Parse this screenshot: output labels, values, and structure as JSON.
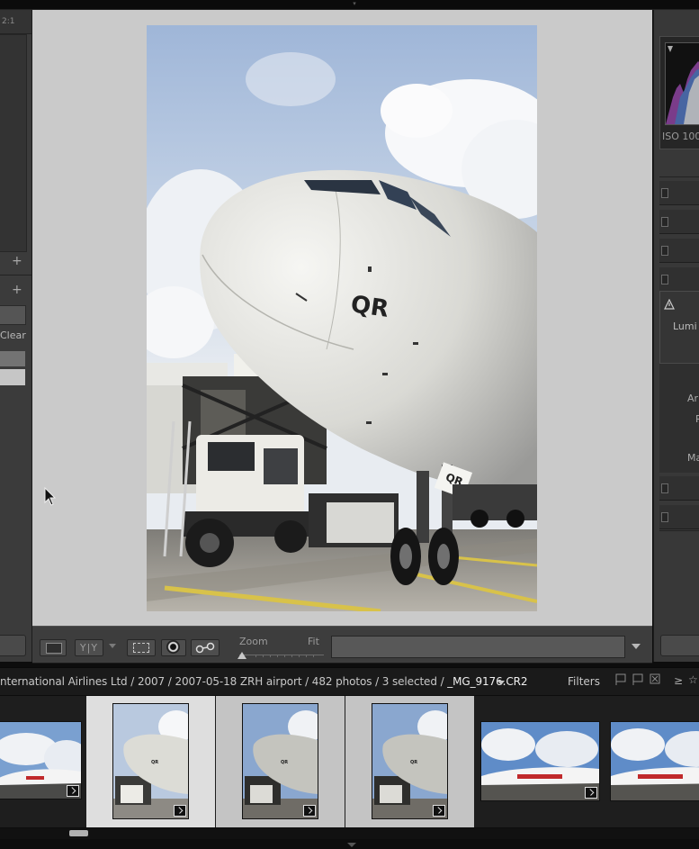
{
  "left_panel": {
    "ratio_label": "2:1",
    "plus_1": "+",
    "plus_2": "+",
    "clear_label": "Clear"
  },
  "toolbar": {
    "compare_label": "Y|Y",
    "zoom_label": "Zoom",
    "fit_label": "Fit"
  },
  "right_panel": {
    "iso_text": "ISO 100",
    "lumi_label": "Lumi",
    "ar_label": "Ar",
    "r_label": "R",
    "ma_label": "Ma"
  },
  "breadcrumb": {
    "path": "nternational Airlines Ltd / 2007 / 2007-05-18 ZRH airport / 482 photos / 3 selected / ",
    "current_file": "_MG_9176.CR2",
    "filters_label": "Filters"
  },
  "photo": {
    "nose_text": "QR",
    "gear_text": "QR"
  },
  "filmstrip": {
    "items": [
      {
        "kind": "landscape",
        "selected": false
      },
      {
        "kind": "portrait",
        "selected": true,
        "active": true
      },
      {
        "kind": "portrait",
        "selected": true
      },
      {
        "kind": "portrait",
        "selected": true
      },
      {
        "kind": "landscape",
        "selected": false
      },
      {
        "kind": "landscape",
        "selected": false
      }
    ]
  },
  "colors": {
    "panel": "#3b3b3b",
    "canvas": "#cacaca",
    "filmstrip": "#1e1e1e",
    "selected_cell": "#c4c4c4",
    "active_cell": "#dedede"
  }
}
